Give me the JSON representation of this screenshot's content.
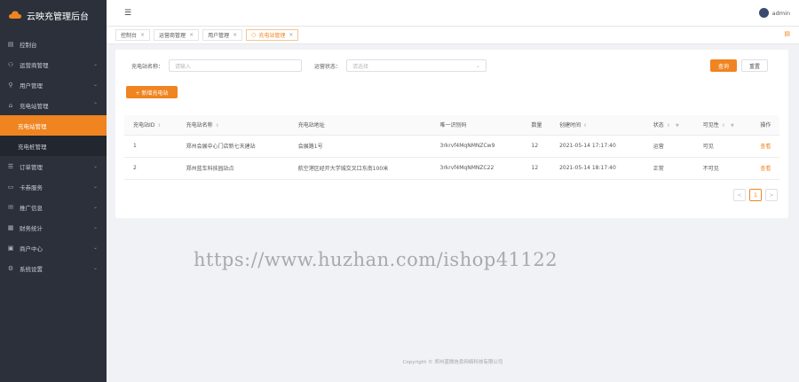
{
  "brand": {
    "title": "云映充管理后台"
  },
  "sidebar": {
    "items": [
      {
        "label": "控制台",
        "icon": "dashboard-icon",
        "arrow": ""
      },
      {
        "label": "运营商管理",
        "icon": "operator-icon",
        "arrow": "⌄"
      },
      {
        "label": "用户管理",
        "icon": "user-icon",
        "arrow": "⌄"
      },
      {
        "label": "充电站管理",
        "icon": "station-icon",
        "arrow": "⌃"
      },
      {
        "label": "充电站管理",
        "icon": "",
        "arrow": "",
        "sub": true,
        "active": true
      },
      {
        "label": "充电桩管理",
        "icon": "",
        "arrow": "",
        "sub": true
      },
      {
        "label": "订单管理",
        "icon": "order-icon",
        "arrow": "⌄"
      },
      {
        "label": "卡券服务",
        "icon": "coupon-icon",
        "arrow": "⌄"
      },
      {
        "label": "推广信息",
        "icon": "promo-icon",
        "arrow": "⌄"
      },
      {
        "label": "财务统计",
        "icon": "finance-icon",
        "arrow": "⌄"
      },
      {
        "label": "商户中心",
        "icon": "merchant-icon",
        "arrow": "⌄"
      },
      {
        "label": "系统设置",
        "icon": "settings-icon",
        "arrow": "⌄"
      }
    ]
  },
  "topbar": {
    "username": "admin"
  },
  "tabs": [
    {
      "label": "控制台",
      "active": false
    },
    {
      "label": "运营商管理",
      "active": false
    },
    {
      "label": "用户管理",
      "active": false
    },
    {
      "label": "充电站管理",
      "active": true
    }
  ],
  "filters": {
    "name_label": "充电站名称：",
    "name_placeholder": "请输入",
    "status_label": "运营状态：",
    "status_placeholder": "请选择",
    "query_label": "查询",
    "reset_label": "重置"
  },
  "add_button": "+ 新增充电站",
  "table": {
    "columns": [
      "充电站ID",
      "充电站名称",
      "充电站地址",
      "唯一识别码",
      "数量",
      "创建时间",
      "状态",
      "可见性",
      "操作"
    ],
    "rows": [
      {
        "id": "1",
        "name": "郑州会展中心门店新七天建站",
        "address": "会展路1号",
        "code": "3rkrvf4MqNMNZCw9",
        "qty": "12",
        "created": "2021-05-14 17:17:40",
        "status": "运营",
        "visible": "可见",
        "action": "查看"
      },
      {
        "id": "2",
        "name": "郑州蓝车科技园站点",
        "address": "航空港区经开大学城交叉口东南100米",
        "code": "3rkrvf4MqNMNZC22",
        "qty": "12",
        "created": "2021-05-14 18:17:40",
        "status": "正常",
        "visible": "不可见",
        "action": "查看"
      }
    ]
  },
  "pager": {
    "prev": "<",
    "current": "1",
    "next": ">"
  },
  "watermark": "https://www.huzhan.com/ishop41122",
  "copyright": "Copyright © 郑州蓝微信息网络科技有限公司",
  "colors": {
    "accent": "#f08420",
    "sidebar_bg": "#2b303b"
  }
}
